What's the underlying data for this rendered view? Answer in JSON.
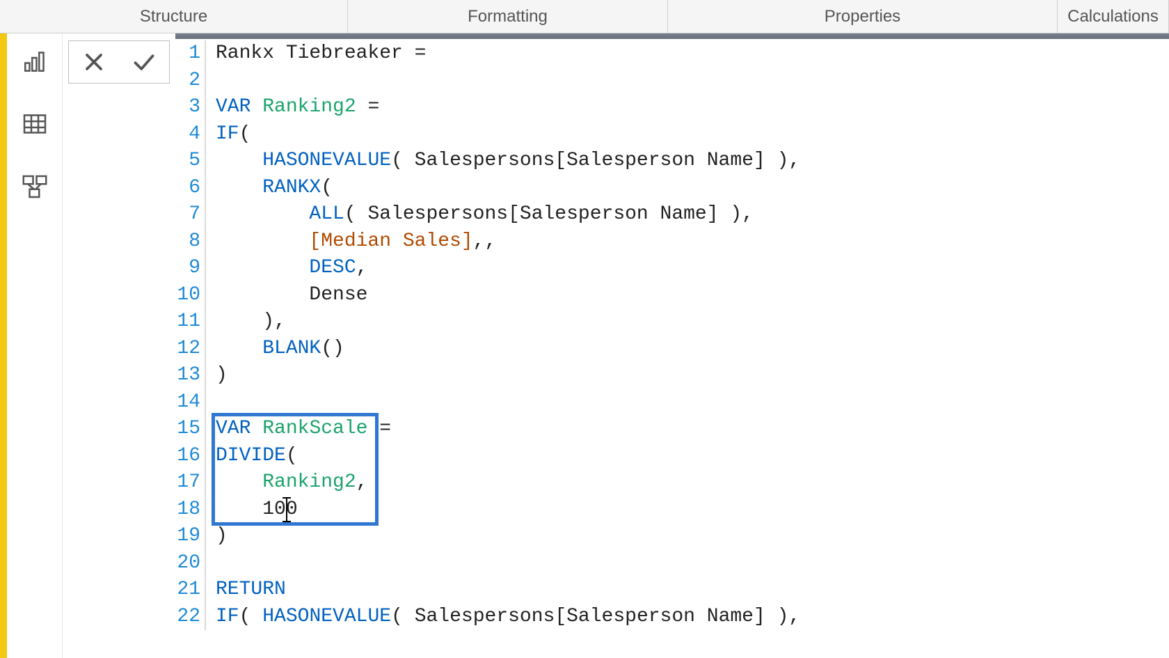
{
  "tabs": {
    "structure": "Structure",
    "formatting": "Formatting",
    "properties": "Properties",
    "calculations": "Calculations"
  },
  "nav": {
    "report": "report-view-icon",
    "data": "data-view-icon",
    "model": "model-view-icon"
  },
  "controls": {
    "cancel": "cancel",
    "confirm": "confirm"
  },
  "code": {
    "measure_name": "Rankx Tiebreaker",
    "eq": " =",
    "var_kw": "VAR",
    "ranking2": "Ranking2",
    "rankscale": "RankScale",
    "if_kw": "IF",
    "hasonevalue": "HASONEVALUE",
    "sp_col": " Salespersons[Salesperson Name] ",
    "rankx": "RANKX",
    "all": "ALL",
    "median_sales": "[Median Sales]",
    "desc": "DESC",
    "dense": "Dense",
    "blank": "BLANK",
    "divide": "DIVIDE",
    "hundred": "100",
    "return_kw": "RETURN",
    "open_p": "(",
    "close_p": ")",
    "comma": ",",
    "dcomma": ",,",
    "eq2": " =",
    "line_numbers": [
      "1",
      "2",
      "3",
      "4",
      "5",
      "6",
      "7",
      "8",
      "9",
      "10",
      "11",
      "12",
      "13",
      "14",
      "15",
      "16",
      "17",
      "18",
      "19",
      "20",
      "21",
      "22"
    ]
  },
  "highlight": {
    "top_line": 15,
    "bottom_line": 18
  }
}
